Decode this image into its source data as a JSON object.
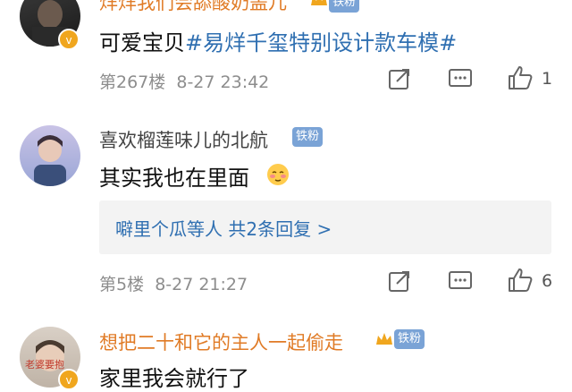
{
  "comments": [
    {
      "username": "烊烊我们会舔酸奶盖儿",
      "badge": "铁粉",
      "text": "可爱宝贝",
      "hashtag": "#易烊千玺特别设计款车模#",
      "floor": "第267楼",
      "time": "8-27 23:42",
      "likes": "1"
    },
    {
      "username": "喜欢榴莲味儿的北航",
      "badge": "铁粉",
      "text": "其实我也在里面",
      "floor": "第5楼",
      "time": "8-27 21:27",
      "likes": "6",
      "replies_summary": "噼里个瓜等人  共2条回复 >"
    },
    {
      "username": "想把二十和它的主人一起偷走",
      "badge": "铁粉",
      "text": "家里我会就行了",
      "avatar_caption": "老婆要抱"
    }
  ],
  "colors": {
    "username_gold": "#e07b26",
    "hashtag_blue": "#2f6fb1",
    "badge_blue": "#7aa3d6"
  }
}
